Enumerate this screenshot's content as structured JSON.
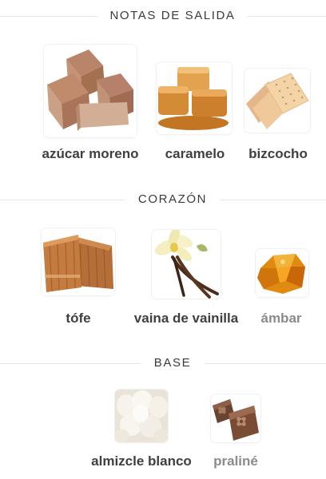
{
  "sections": [
    {
      "title": "NOTAS DE SALIDA",
      "notes": [
        {
          "label": "azúcar moreno",
          "icon": "brown-sugar-cubes-icon",
          "prominent": true
        },
        {
          "label": "caramelo",
          "icon": "caramel-cubes-icon",
          "prominent": true
        },
        {
          "label": "bizcocho",
          "icon": "biscuit-crackers-icon",
          "prominent": true
        }
      ]
    },
    {
      "title": "CORAZÓN",
      "notes": [
        {
          "label": "tófe",
          "icon": "toffee-bars-icon",
          "prominent": true
        },
        {
          "label": "vaina de vainilla",
          "icon": "vanilla-pod-flower-icon",
          "prominent": true
        },
        {
          "label": "ámbar",
          "icon": "amber-resin-icon",
          "prominent": false
        }
      ]
    },
    {
      "title": "BASE",
      "notes": [
        {
          "label": "almizcle blanco",
          "icon": "white-musk-icon",
          "prominent": true
        },
        {
          "label": "praliné",
          "icon": "praline-chocolate-icon",
          "prominent": false
        }
      ]
    }
  ]
}
